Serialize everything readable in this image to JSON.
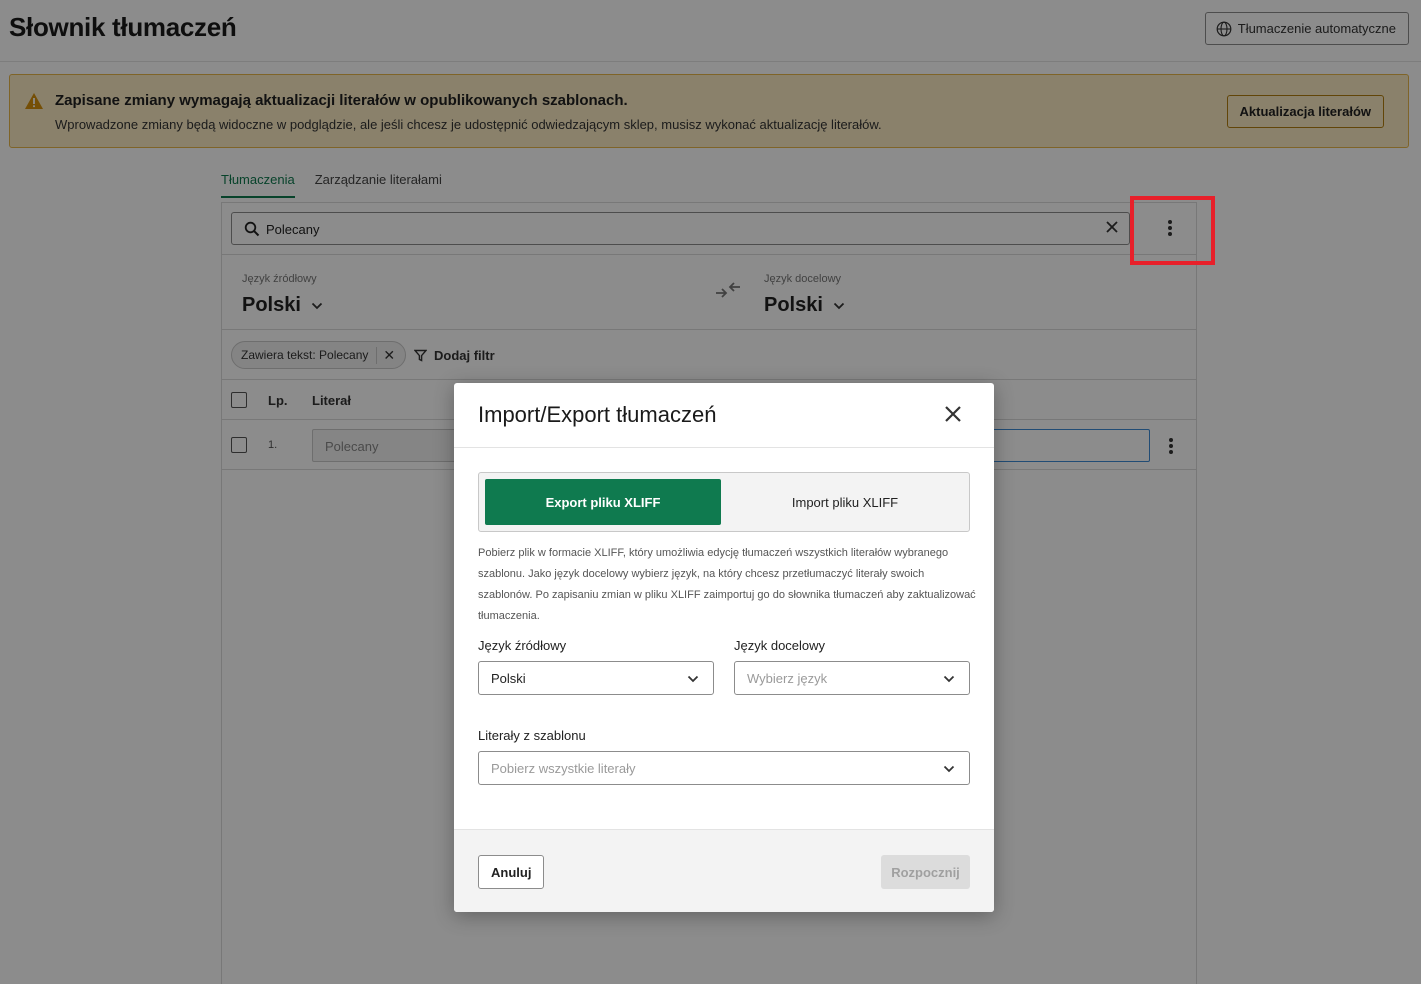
{
  "header": {
    "title": "Słownik tłumaczeń",
    "auto_translate_label": "Tłumaczenie automatyczne"
  },
  "warning": {
    "title": "Zapisane zmiany wymagają aktualizacji literałów w opublikowanych szablonach.",
    "text": "Wprowadzone zmiany będą widoczne w podglądzie, ale jeśli chcesz je udostępnić odwiedzającym sklep, musisz wykonać aktualizację literałów.",
    "button_label": "Aktualizacja literałów"
  },
  "tabs": [
    {
      "label": "Tłumaczenia",
      "active": true
    },
    {
      "label": "Zarządzanie literałami",
      "active": false
    }
  ],
  "search": {
    "value": "Polecany"
  },
  "languages": {
    "source_label": "Język źródłowy",
    "source_value": "Polski",
    "target_label": "Język docelowy",
    "target_value": "Polski"
  },
  "filters": {
    "chip_label": "Zawiera tekst: Polecany",
    "add_filter_label": "Dodaj filtr"
  },
  "table": {
    "columns": [
      "Lp.",
      "Literał"
    ],
    "rows": [
      {
        "num": "1.",
        "literal": "Polecany"
      }
    ]
  },
  "modal": {
    "title": "Import/Export tłumaczeń",
    "tab_export": "Export pliku XLIFF",
    "tab_import": "Import pliku XLIFF",
    "description": "Pobierz plik w formacie XLIFF, który umożliwia edycję tłumaczeń wszystkich literałów wybranego szablonu. Jako język docelowy wybierz język, na który chcesz przetłumaczyć literały swoich szablonów. Po zapisaniu zmian w pliku XLIFF zaimportuj go do słownika tłumaczeń aby zaktualizować tłumaczenia.",
    "source_label": "Język źródłowy",
    "source_value": "Polski",
    "target_label": "Język docelowy",
    "target_placeholder": "Wybierz język",
    "literals_label": "Literały z szablonu",
    "literals_placeholder": "Pobierz wszystkie literały",
    "cancel_label": "Anuluj",
    "start_label": "Rozpocznij"
  },
  "colors": {
    "accent": "#0f7a4f",
    "warning_bg": "#fbecc4",
    "highlight": "#e8202a"
  },
  "icons": [
    "globe-icon",
    "warning-icon",
    "search-icon",
    "clear-icon",
    "more-vertical-icon",
    "swap-icon",
    "chevron-down-icon",
    "filter-icon",
    "close-icon"
  ]
}
